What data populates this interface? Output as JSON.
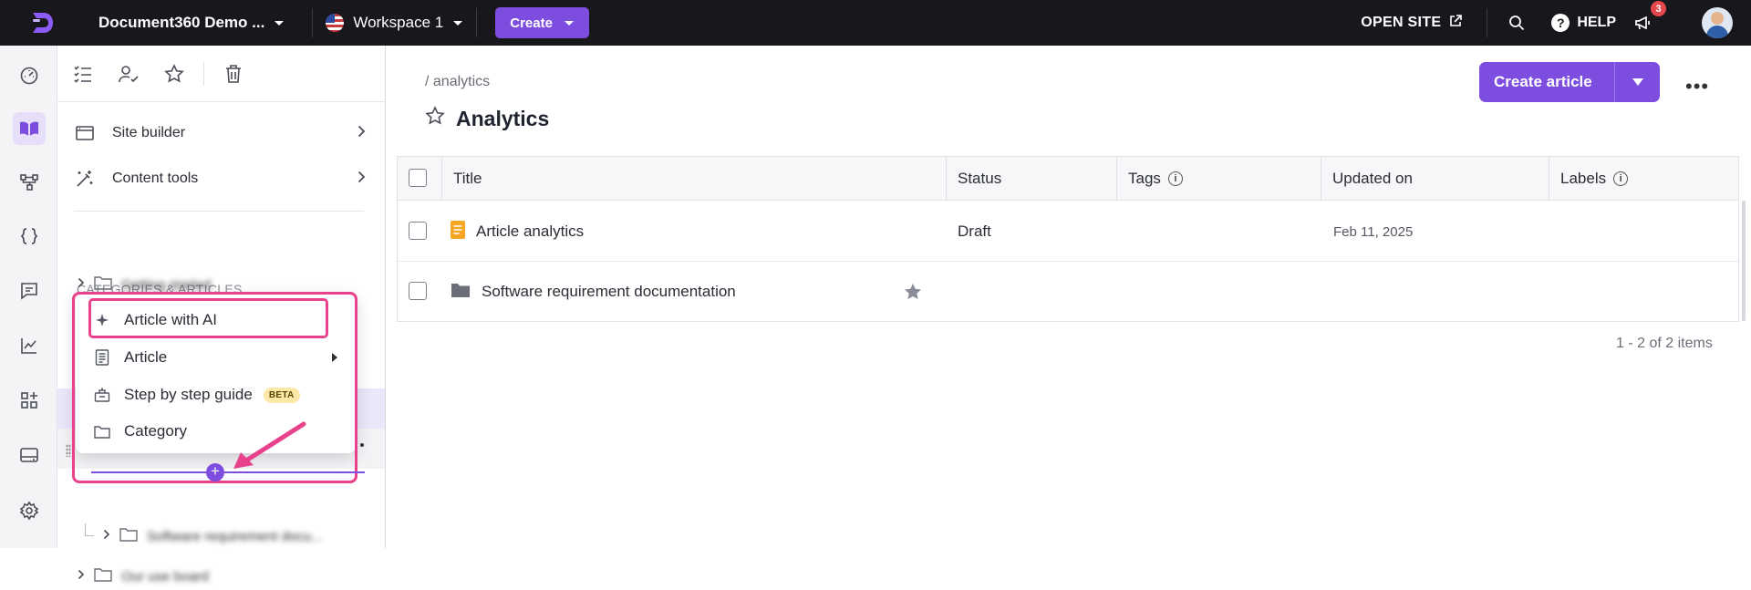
{
  "topbar": {
    "project_name": "Document360 Demo ...",
    "workspace": "Workspace 1",
    "create_label": "Create",
    "open_site_label": "OPEN SITE",
    "help_label": "HELP",
    "help_glyph": "?",
    "notification_count": "3",
    "colors": {
      "background": "#17171c",
      "accent": "#7c4dde"
    }
  },
  "rail": {
    "icons": [
      "dashboard-icon",
      "documentation-icon",
      "api-icon",
      "code-icon",
      "feedback-icon",
      "analytics-icon",
      "widgets-icon",
      "drive-icon",
      "settings-icon"
    ],
    "active": "documentation-icon"
  },
  "panel": {
    "tool_icons": [
      "checklist-icon",
      "user-check-icon",
      "star-icon",
      "trash-icon"
    ],
    "nav": [
      {
        "label": "Site builder",
        "icon": "browser-icon"
      },
      {
        "label": "Content tools",
        "icon": "magic-tools-icon"
      }
    ],
    "categories_title": "CATEGORIES & ARTICLES",
    "tree": [
      {
        "label": "Getting started",
        "blurred": true
      },
      {
        "label": "Software requirement docu...",
        "blurred": true
      },
      {
        "label": "Our use board",
        "blurred": true
      }
    ]
  },
  "context_menu": {
    "items": [
      {
        "label": "Article with AI",
        "icon": "sparkle-icon",
        "highlighted": true
      },
      {
        "label": "Article",
        "icon": "document-icon",
        "has_submenu": true
      },
      {
        "label": "Step by step guide",
        "icon": "guide-icon",
        "badge": "BETA"
      },
      {
        "label": "Category",
        "icon": "folder-icon"
      }
    ],
    "plus_glyph": "+"
  },
  "main": {
    "breadcrumb": "/ analytics",
    "title": "Analytics",
    "create_article_label": "Create article",
    "more_glyph": "•••",
    "info_glyph": "i",
    "columns": [
      "Title",
      "Status",
      "Tags",
      "Updated on",
      "Labels"
    ],
    "rows": [
      {
        "title": "Article analytics",
        "icon": "article-icon",
        "status": "Draft",
        "tags": "",
        "updated_on": "Feb 11, 2025",
        "labels": ""
      },
      {
        "title": "Software requirement documentation",
        "icon": "folder-icon",
        "status": "",
        "tags": "",
        "updated_on": "",
        "labels": "",
        "starred": true
      }
    ],
    "pagination": "1 - 2 of 2 items"
  }
}
